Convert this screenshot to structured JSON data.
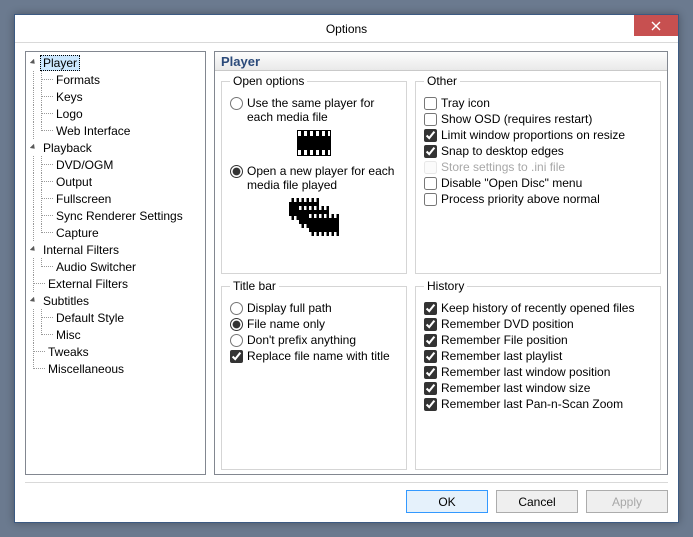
{
  "window": {
    "title": "Options"
  },
  "panel": {
    "title": "Player"
  },
  "tree": [
    {
      "label": "Player",
      "selected": true,
      "children": [
        {
          "label": "Formats"
        },
        {
          "label": "Keys"
        },
        {
          "label": "Logo"
        },
        {
          "label": "Web Interface",
          "last": true
        }
      ]
    },
    {
      "label": "Playback",
      "children": [
        {
          "label": "DVD/OGM"
        },
        {
          "label": "Output"
        },
        {
          "label": "Fullscreen"
        },
        {
          "label": "Sync Renderer Settings"
        },
        {
          "label": "Capture",
          "last": true
        }
      ]
    },
    {
      "label": "Internal Filters",
      "children": [
        {
          "label": "Audio Switcher",
          "last": true
        }
      ]
    },
    {
      "label": "External Filters",
      "leaf": true
    },
    {
      "label": "Subtitles",
      "children": [
        {
          "label": "Default Style"
        },
        {
          "label": "Misc",
          "last": true
        }
      ]
    },
    {
      "label": "Tweaks",
      "leaf": true
    },
    {
      "label": "Miscellaneous",
      "leaf": true,
      "last": true
    }
  ],
  "groups": {
    "open": {
      "legend": "Open options",
      "same": "Use the same player for each media file",
      "new": "Open a new player for each media file played",
      "selected": "new"
    },
    "other": {
      "legend": "Other",
      "items": [
        {
          "label": "Tray icon",
          "checked": false
        },
        {
          "label": "Show OSD (requires restart)",
          "checked": false
        },
        {
          "label": "Limit window proportions on resize",
          "checked": true
        },
        {
          "label": "Snap to desktop edges",
          "checked": true
        },
        {
          "label": "Store settings to .ini file",
          "checked": false,
          "disabled": true
        },
        {
          "label": "Disable \"Open Disc\" menu",
          "checked": false
        },
        {
          "label": "Process priority above normal",
          "checked": false
        }
      ]
    },
    "titlebar": {
      "legend": "Title bar",
      "radios": [
        {
          "label": "Display full path",
          "value": "full"
        },
        {
          "label": "File name only",
          "value": "name"
        },
        {
          "label": "Don't prefix anything",
          "value": "none"
        }
      ],
      "selected": "name",
      "replace": {
        "label": "Replace file name with title",
        "checked": true
      }
    },
    "history": {
      "legend": "History",
      "items": [
        {
          "label": "Keep history of recently opened files",
          "checked": true
        },
        {
          "label": "Remember DVD position",
          "checked": true
        },
        {
          "label": "Remember File position",
          "checked": true
        },
        {
          "label": "Remember last playlist",
          "checked": true
        },
        {
          "label": "Remember last window position",
          "checked": true
        },
        {
          "label": "Remember last window size",
          "checked": true
        },
        {
          "label": "Remember last Pan-n-Scan Zoom",
          "checked": true
        }
      ]
    }
  },
  "buttons": {
    "ok": "OK",
    "cancel": "Cancel",
    "apply": "Apply"
  }
}
